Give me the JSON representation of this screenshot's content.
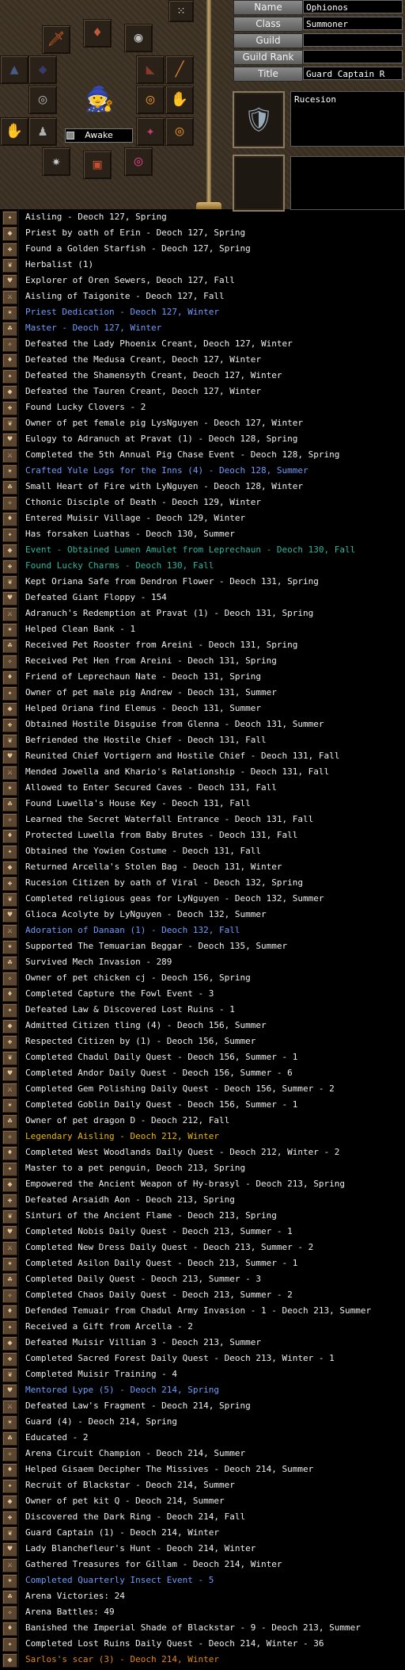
{
  "profile": {
    "labels": {
      "name": "Name",
      "class": "Class",
      "guild": "Guild",
      "guild_rank": "Guild Rank",
      "title": "Title"
    },
    "values": {
      "name": "Ophionos",
      "class": "Summoner",
      "guild": "",
      "guild_rank": "",
      "title": "Guard Captain R"
    },
    "nation_text": "Rucesion",
    "status": "Awake"
  },
  "equipment": [
    {
      "name": "helm-icon",
      "glyph": "🗡"
    },
    {
      "name": "earring-icon",
      "glyph": "♦"
    },
    {
      "name": "necklace-icon",
      "glyph": "◉"
    },
    {
      "name": "armor-icon",
      "glyph": "▲"
    },
    {
      "name": "shield-icon",
      "glyph": "◆"
    },
    {
      "name": "overcoat-icon",
      "glyph": "◣"
    },
    {
      "name": "weapon-icon",
      "glyph": "╱"
    },
    {
      "name": "belt-icon",
      "glyph": "◎"
    },
    {
      "name": "ring-left-icon",
      "glyph": "◎"
    },
    {
      "name": "gauntlet-left-icon",
      "glyph": "✋"
    },
    {
      "name": "gauntlet-right-icon",
      "glyph": "✋"
    },
    {
      "name": "boots-icon",
      "glyph": "♟"
    },
    {
      "name": "accessory-icon",
      "glyph": "✦"
    },
    {
      "name": "ring-right-icon",
      "glyph": "◎"
    }
  ],
  "colors": {
    "white": "#eeeeee",
    "blue": "#6f9cff",
    "teal": "#2ab7a0",
    "gold": "#f0b800",
    "orange": "#e8860a"
  },
  "legends": [
    {
      "text": "Aisling - Deoch 127, Spring",
      "color": "white"
    },
    {
      "text": "Priest by oath of Erin - Deoch 127, Spring",
      "color": "white"
    },
    {
      "text": "Found a Golden Starfish - Deoch 127, Spring",
      "color": "white"
    },
    {
      "text": "Herbalist (1)",
      "color": "white"
    },
    {
      "text": "Explorer of Oren Sewers, Deoch 127, Fall",
      "color": "white"
    },
    {
      "text": "Aisling of Taigonite - Deoch 127, Fall",
      "color": "white"
    },
    {
      "text": "Priest Dedication - Deoch 127, Winter",
      "color": "blue"
    },
    {
      "text": "Master - Deoch 127, Winter",
      "color": "blue"
    },
    {
      "text": "Defeated the Lady Phoenix Creant, Deoch 127, Winter",
      "color": "white"
    },
    {
      "text": "Defeated the Medusa Creant, Deoch 127, Winter",
      "color": "white"
    },
    {
      "text": "Defeated the Shamensyth Creant, Deoch 127, Winter",
      "color": "white"
    },
    {
      "text": "Defeated the Tauren Creant, Deoch 127, Winter",
      "color": "white"
    },
    {
      "text": "Found Lucky Clovers - 2",
      "color": "white"
    },
    {
      "text": "Owner of pet female pig LysNguyen - Deoch 127, Winter",
      "color": "white"
    },
    {
      "text": "Eulogy to Adranuch at Pravat (1) - Deoch 128, Spring",
      "color": "white"
    },
    {
      "text": "Completed the 5th Annual Pig Chase Event - Deoch 128, Spring",
      "color": "white"
    },
    {
      "text": "Crafted Yule Logs for the Inns (4) - Deoch 128, Summer",
      "color": "blue"
    },
    {
      "text": "Small Heart of Fire with LyNguyen - Deoch 128, Winter",
      "color": "white"
    },
    {
      "text": "Cthonic Disciple of Death - Deoch 129, Winter",
      "color": "white"
    },
    {
      "text": "Entered Muisir Village - Deoch 129, Winter",
      "color": "white"
    },
    {
      "text": "Has forsaken Luathas - Deoch 130, Summer",
      "color": "white"
    },
    {
      "text": "Event - Obtained Lumen Amulet from Leprechaun - Deoch 130, Fall",
      "color": "teal"
    },
    {
      "text": "Found Lucky Charms - Deoch 130, Fall",
      "color": "teal"
    },
    {
      "text": "Kept Oriana Safe from Dendron Flower - Deoch 131, Spring",
      "color": "white"
    },
    {
      "text": "Defeated Giant Floppy - 154",
      "color": "white"
    },
    {
      "text": "Adranuch's Redemption at Pravat (1) - Deoch 131, Spring",
      "color": "white"
    },
    {
      "text": "Helped Clean Bank - 1",
      "color": "white"
    },
    {
      "text": "Received Pet Rooster from Areini - Deoch 131, Spring",
      "color": "white"
    },
    {
      "text": "Received Pet Hen from Areini - Deoch 131, Spring",
      "color": "white"
    },
    {
      "text": "Friend of Leprechaun Nate - Deoch 131, Spring",
      "color": "white"
    },
    {
      "text": "Owner of pet male pig Andrew - Deoch 131, Summer",
      "color": "white"
    },
    {
      "text": "Helped Oriana find Elemus - Deoch 131, Summer",
      "color": "white"
    },
    {
      "text": "Obtained Hostile Disguise from Glenna - Deoch 131, Summer",
      "color": "white"
    },
    {
      "text": "Befriended the Hostile Chief - Deoch 131, Fall",
      "color": "white"
    },
    {
      "text": "Reunited Chief Vortigern and Hostile Chief - Deoch 131, Fall",
      "color": "white"
    },
    {
      "text": "Mended Jowella and Khario's Relationship - Deoch 131, Fall",
      "color": "white"
    },
    {
      "text": "Allowed to Enter Secured Caves - Deoch 131, Fall",
      "color": "white"
    },
    {
      "text": "Found Luwella's House Key - Deoch 131, Fall",
      "color": "white"
    },
    {
      "text": "Learned the Secret Waterfall Entrance - Deoch 131, Fall",
      "color": "white"
    },
    {
      "text": "Protected Luwella from Baby Brutes - Deoch 131, Fall",
      "color": "white"
    },
    {
      "text": "Obtained the Yowien Costume - Deoch 131, Fall",
      "color": "white"
    },
    {
      "text": "Returned Arcella's Stolen Bag - Deoch 131, Winter",
      "color": "white"
    },
    {
      "text": "Rucesion Citizen by oath of Viral - Deoch 132, Spring",
      "color": "white"
    },
    {
      "text": "Completed religious geas for LyNguyen - Deoch 132, Summer",
      "color": "white"
    },
    {
      "text": "Glioca Acolyte by LyNguyen - Deoch 132, Summer",
      "color": "white"
    },
    {
      "text": "Adoration of Danaan (1) - Deoch 132, Fall",
      "color": "blue"
    },
    {
      "text": "Supported The Temuarian Beggar - Deoch 135, Summer",
      "color": "white"
    },
    {
      "text": "Survived Mech Invasion - 289",
      "color": "white"
    },
    {
      "text": "Owner of pet chicken cj - Deoch 156, Spring",
      "color": "white"
    },
    {
      "text": "Completed Capture the Fowl Event - 3",
      "color": "white"
    },
    {
      "text": "Defeated Law & Discovered Lost Ruins - 1",
      "color": "white"
    },
    {
      "text": "Admitted Citizen tling (4) - Deoch 156, Summer",
      "color": "white"
    },
    {
      "text": "Respected Citizen by  (1) - Deoch 156, Summer",
      "color": "white"
    },
    {
      "text": "Completed Chadul Daily Quest - Deoch 156, Summer - 1",
      "color": "white"
    },
    {
      "text": "Completed Andor Daily Quest - Deoch 156, Summer - 6",
      "color": "white"
    },
    {
      "text": "Completed Gem Polishing Daily Quest - Deoch 156, Summer - 2",
      "color": "white"
    },
    {
      "text": "Completed Goblin Daily Quest - Deoch 156, Summer - 1",
      "color": "white"
    },
    {
      "text": "Owner of pet dragon D - Deoch 212, Fall",
      "color": "white"
    },
    {
      "text": "Legendary Aisling - Deoch 212, Winter",
      "color": "gold"
    },
    {
      "text": "Completed West Woodlands Daily Quest - Deoch 212, Winter - 2",
      "color": "white"
    },
    {
      "text": "Master to a pet penguin, Deoch 213, Spring",
      "color": "white"
    },
    {
      "text": "Empowered the Ancient Weapon of Hy-brasyl - Deoch 213, Spring",
      "color": "white"
    },
    {
      "text": "Defeated Arsaidh Aon - Deoch 213, Spring",
      "color": "white"
    },
    {
      "text": "Sinturi of the Ancient Flame - Deoch 213, Spring",
      "color": "white"
    },
    {
      "text": "Completed Nobis Daily Quest - Deoch 213, Summer - 1",
      "color": "white"
    },
    {
      "text": "Completed New Dress Daily Quest - Deoch 213, Summer - 2",
      "color": "white"
    },
    {
      "text": "Completed Asilon Daily Quest - Deoch 213, Summer - 1",
      "color": "white"
    },
    {
      "text": "Completed Daily Quest - Deoch 213, Summer - 3",
      "color": "white"
    },
    {
      "text": "Completed Chaos Daily Quest - Deoch 213, Summer - 2",
      "color": "white"
    },
    {
      "text": "Defended Temuair from Chadul Army Invasion - 1 - Deoch 213, Summer",
      "color": "white"
    },
    {
      "text": "Received a Gift from Arcella - 2",
      "color": "white"
    },
    {
      "text": "Defeated Muisir Villian 3 - Deoch 213, Summer",
      "color": "white"
    },
    {
      "text": "Completed Sacred Forest Daily Quest - Deoch 213, Winter - 1",
      "color": "white"
    },
    {
      "text": "Completed Muisir Training - 4",
      "color": "white"
    },
    {
      "text": "Mentored Lype (5) - Deoch 214, Spring",
      "color": "blue"
    },
    {
      "text": "Defeated Law's Fragment - Deoch 214, Spring",
      "color": "white"
    },
    {
      "text": "Guard (4) - Deoch 214, Spring",
      "color": "white"
    },
    {
      "text": "Educated - 2",
      "color": "white"
    },
    {
      "text": "Arena Circuit Champion - Deoch 214, Summer",
      "color": "white"
    },
    {
      "text": "Helped Gisaem Decipher The Missives - Deoch 214, Summer",
      "color": "white"
    },
    {
      "text": "Recruit of Blackstar - Deoch 214, Summer",
      "color": "white"
    },
    {
      "text": "Owner of pet kit Q - Deoch 214, Summer",
      "color": "white"
    },
    {
      "text": "Discovered the Dark Ring - Deoch 214, Fall",
      "color": "white"
    },
    {
      "text": "Guard Captain (1) - Deoch 214, Winter",
      "color": "white"
    },
    {
      "text": "Lady Blanchefleur's Hunt - Deoch 214, Winter",
      "color": "white"
    },
    {
      "text": "Gathered Treasures for Gillam - Deoch 214, Winter",
      "color": "white"
    },
    {
      "text": "Completed Quarterly Insect Event - 5",
      "color": "blue"
    },
    {
      "text": "Arena Victories: 24",
      "color": "white"
    },
    {
      "text": "Arena Battles: 49",
      "color": "white"
    },
    {
      "text": "Banished the Imperial Shade of Blackstar - 9 - Deoch 213, Summer",
      "color": "white"
    },
    {
      "text": "Completed Lost Ruins Daily Quest - Deoch 214, Winter - 36",
      "color": "white"
    },
    {
      "text": "Sarlos's scar (3) - Deoch 214, Winter",
      "color": "orange"
    }
  ],
  "legend_icons": [
    "✦",
    "◆",
    "✚",
    "❦",
    "♥",
    "⚔",
    "✶",
    "☘",
    "✧",
    "♦"
  ]
}
